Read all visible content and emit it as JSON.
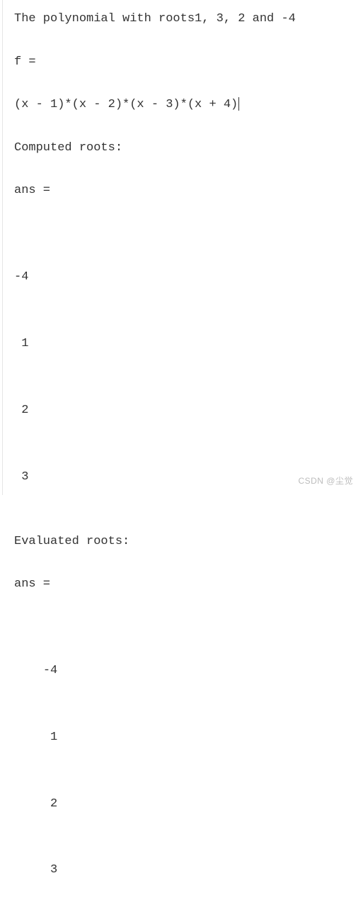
{
  "header": "The polynomial with roots1, 3, 2 and -4",
  "var_name": "f =",
  "formula": "(x - 1)*(x - 2)*(x - 3)*(x + 4)",
  "computed_label": "Computed roots:",
  "ans_label": "ans =",
  "computed_roots": [
    "-4",
    " 1",
    " 2",
    " 3"
  ],
  "evaluated_label": "Evaluated roots:",
  "evaluated_roots": [
    "-4",
    " 1",
    " 2",
    " 3"
  ],
  "watermark": "CSDN @尘觉"
}
